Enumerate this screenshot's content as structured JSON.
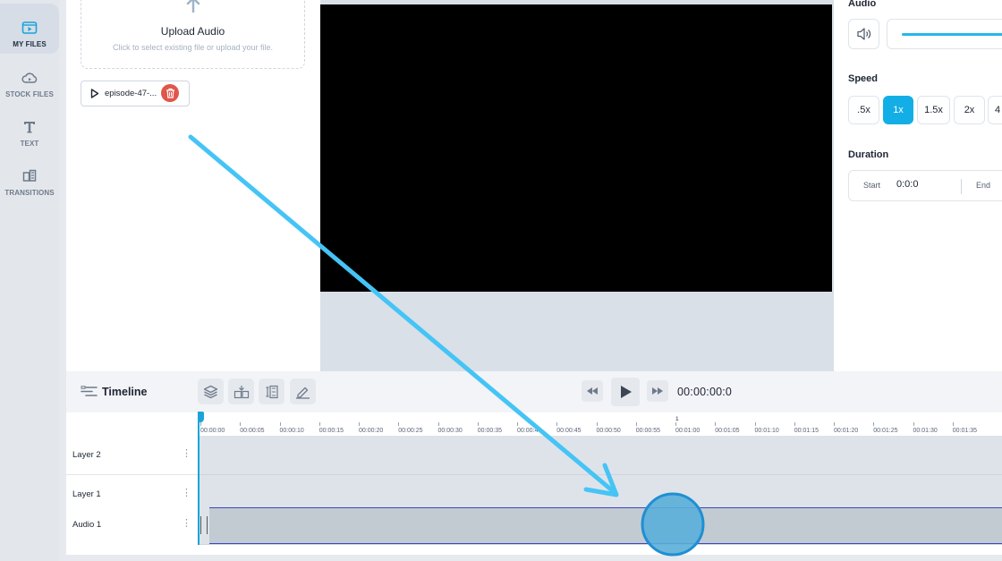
{
  "rail": {
    "items": [
      {
        "label": "MY FILES",
        "icon": "folder-play-icon",
        "active": true
      },
      {
        "label": "STOCK FILES",
        "icon": "cloud-play-icon"
      },
      {
        "label": "TEXT",
        "icon": "text-icon"
      },
      {
        "label": "TRANSITIONS",
        "icon": "transitions-icon"
      }
    ]
  },
  "files": {
    "upload_title": "Upload Audio",
    "upload_subtitle": "Click to select existing file or upload your file.",
    "file_name": "episode-47-..."
  },
  "panel": {
    "audio_heading": "Audio",
    "volume_level": 1.0,
    "speed_heading": "Speed",
    "speeds": [
      ".5x",
      "1x",
      "1.5x",
      "2x",
      "4"
    ],
    "active_speed": "1x",
    "duration_heading": "Duration",
    "start_label": "Start",
    "start_value": "0:0:0",
    "end_label": "End"
  },
  "timeline": {
    "title": "Timeline",
    "time": "00:00:00:0",
    "ruler_mark": "1",
    "ticks": [
      "00:00:00",
      "00:00:05",
      "00:00:10",
      "00:00:15",
      "00:00:20",
      "00:00:25",
      "00:00:30",
      "00:00:35",
      "00:00:40",
      "00:00:45",
      "00:00:50",
      "00:00:55",
      "00:01:00",
      "00:01:05",
      "00:01:10",
      "00:01:15",
      "00:01:20",
      "00:01:25",
      "00:01:30",
      "00:01:35"
    ],
    "layers": [
      "Layer 2",
      "Layer 1",
      "Audio 1"
    ]
  },
  "colors": {
    "accent": "#14aee6",
    "annotation": "#45c4f5",
    "delete": "#e0564a"
  }
}
